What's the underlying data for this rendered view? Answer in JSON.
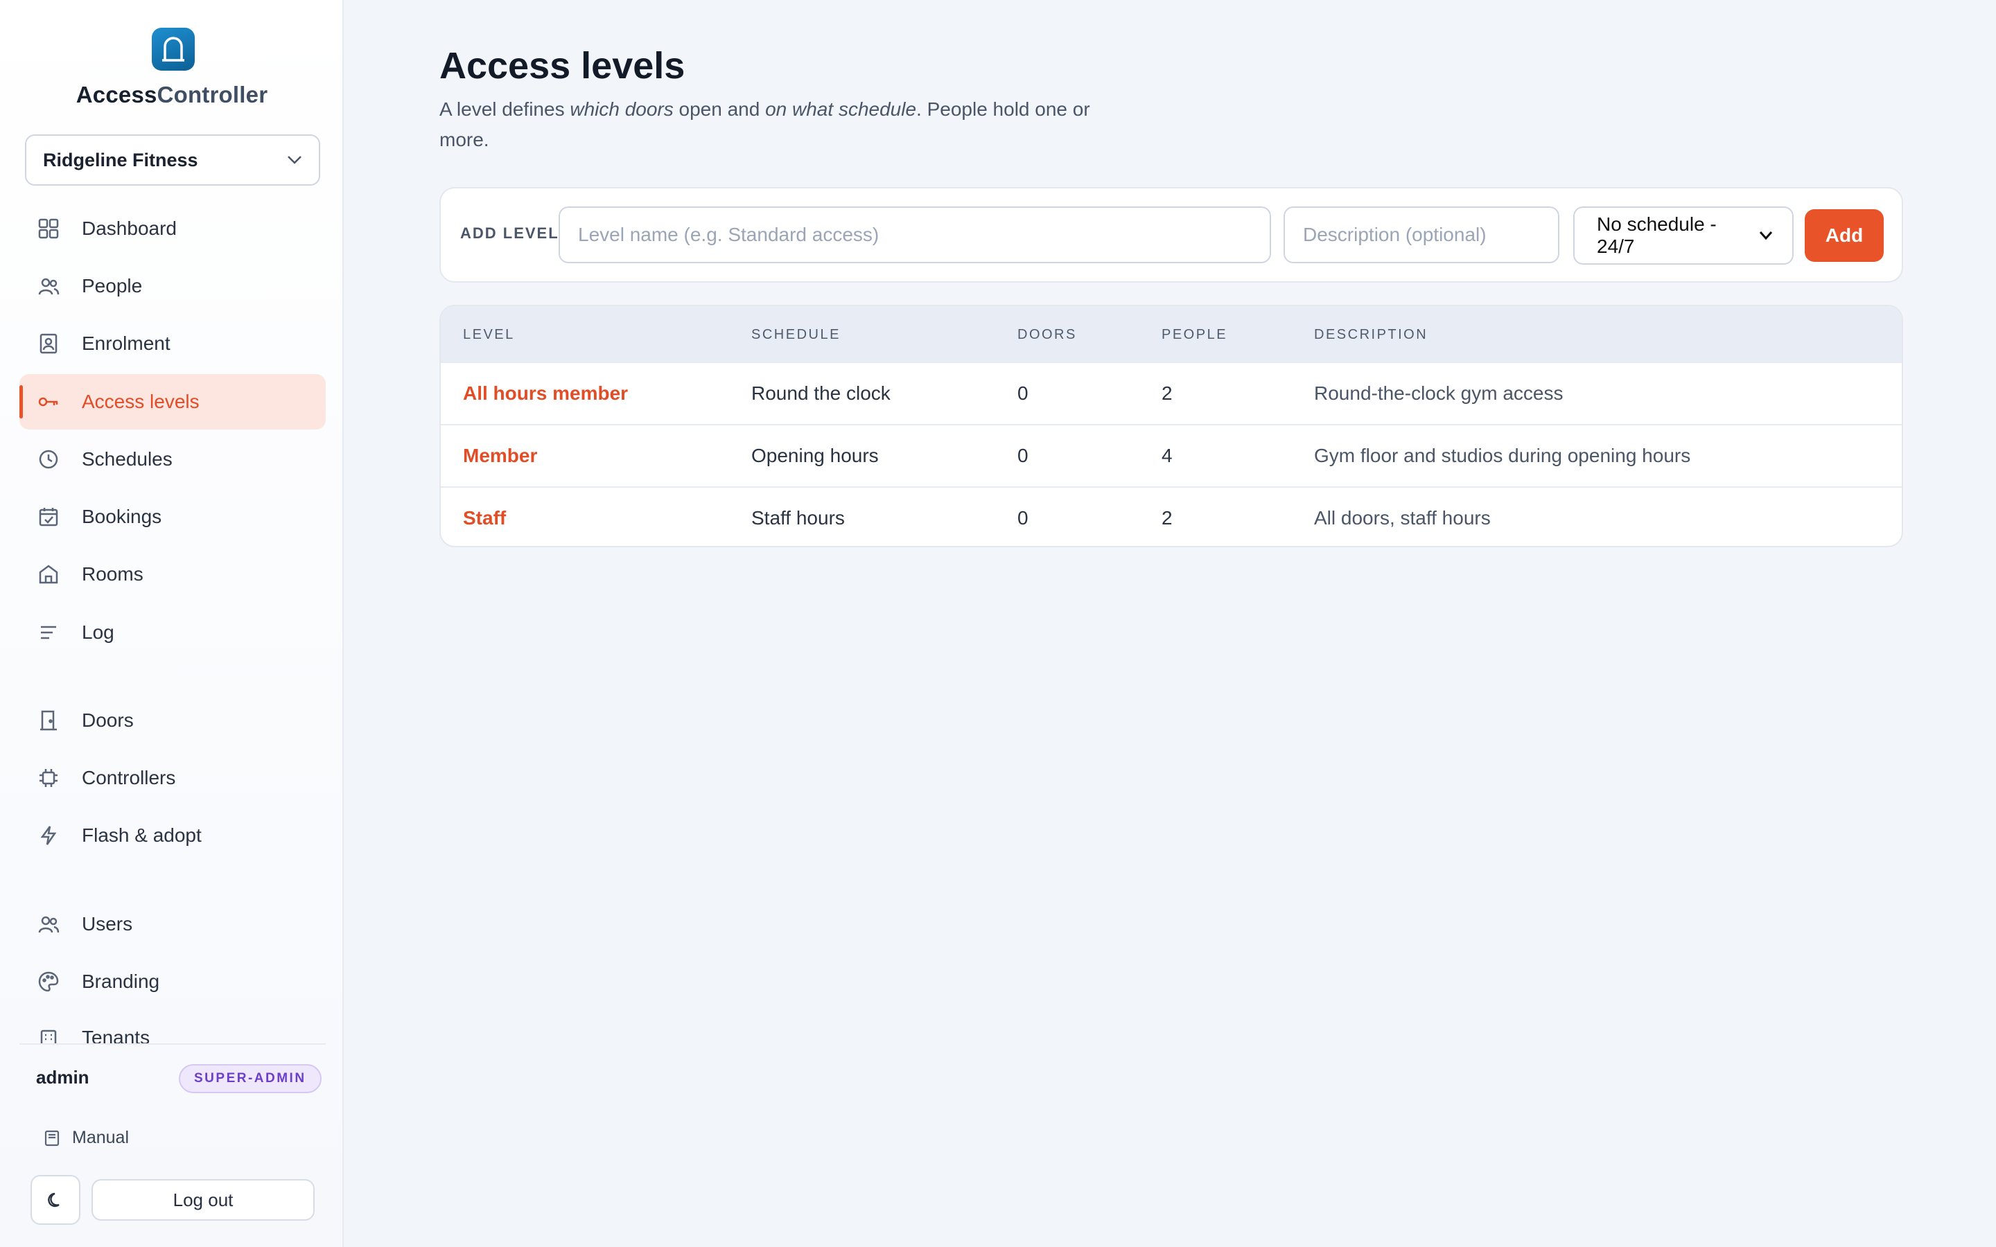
{
  "app": {
    "name_part1": "Access",
    "name_part2": "Controller"
  },
  "tenant": {
    "selected": "Ridgeline Fitness"
  },
  "nav": {
    "dashboard": "Dashboard",
    "people": "People",
    "enrolment": "Enrolment",
    "access_levels": "Access levels",
    "schedules": "Schedules",
    "bookings": "Bookings",
    "rooms": "Rooms",
    "log": "Log",
    "doors": "Doors",
    "controllers": "Controllers",
    "flash_adopt": "Flash & adopt",
    "users": "Users",
    "branding": "Branding",
    "tenants": "Tenants"
  },
  "user": {
    "name": "admin",
    "role": "SUPER-ADMIN"
  },
  "footer": {
    "manual": "Manual",
    "logout": "Log out"
  },
  "page": {
    "title": "Access levels",
    "desc_1": "A level defines ",
    "desc_2": "which doors",
    "desc_3": " open and ",
    "desc_4": "on what schedule",
    "desc_5": ". People hold one or more."
  },
  "add_form": {
    "label": "ADD LEVEL",
    "name_placeholder": "Level name (e.g. Standard access)",
    "name_value": "",
    "desc_placeholder": "Description (optional)",
    "desc_value": "",
    "schedule_selected": "No schedule - 24/7",
    "add_button": "Add"
  },
  "table": {
    "headers": [
      "LEVEL",
      "SCHEDULE",
      "DOORS",
      "PEOPLE",
      "DESCRIPTION"
    ],
    "rows": [
      [
        "All hours member",
        "Round the clock",
        "0",
        "2",
        "Round-the-clock gym access"
      ],
      [
        "Member",
        "Opening hours",
        "0",
        "4",
        "Gym floor and studios during opening hours"
      ],
      [
        "Staff",
        "Staff hours",
        "0",
        "2",
        "All doors, staff hours"
      ]
    ]
  },
  "colors": {
    "accent": "#e8532a",
    "active_bg": "#fde5e0",
    "badge_bg": "#efe8fd",
    "badge_fg": "#6b3fc8",
    "logo": "#1479b8"
  },
  "icons": {
    "logo": "door-arch-icon",
    "tenant_chevron": "chevron-down-icon",
    "dashboard": "grid-icon",
    "people": "people-icon",
    "enrolment": "id-badge-icon",
    "access_levels": "key-icon",
    "schedules": "clock-icon",
    "bookings": "calendar-check-icon",
    "rooms": "house-icon",
    "log": "lines-icon",
    "doors": "door-icon",
    "controllers": "chip-icon",
    "flash_adopt": "lightning-icon",
    "users": "people-icon",
    "branding": "palette-icon",
    "tenants": "building-icon",
    "manual": "book-icon",
    "theme": "moon-icon"
  }
}
